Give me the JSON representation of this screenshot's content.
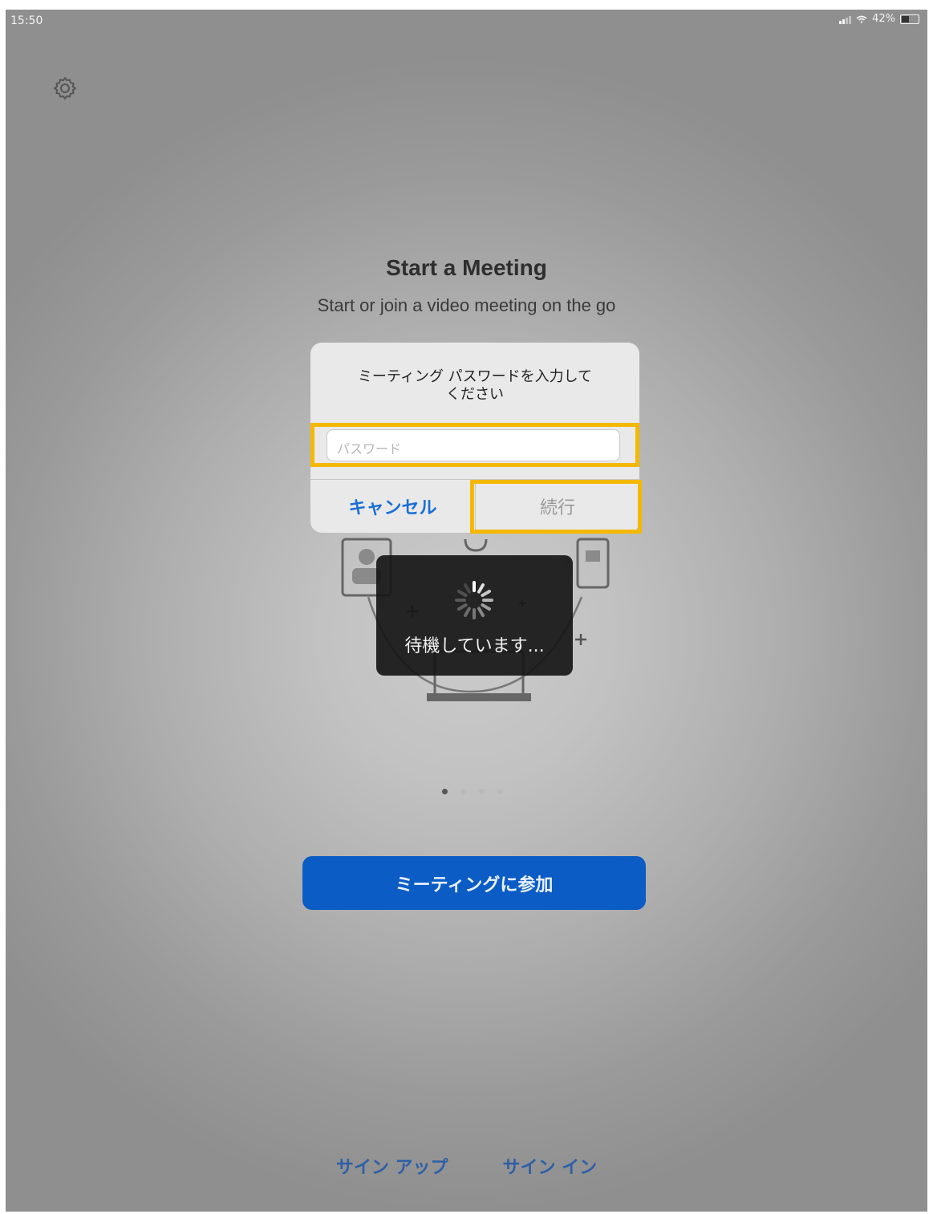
{
  "status_bar": {
    "time": "15:50",
    "battery": "42%"
  },
  "header": {
    "title": "Start a Meeting",
    "subtitle": "Start or join a video meeting on the go"
  },
  "password_dialog": {
    "title": "ミーティング パスワードを入力して\nください",
    "input_placeholder": "パスワード",
    "cancel_label": "キャンセル",
    "continue_label": "続行"
  },
  "loading": {
    "text": "待機しています..."
  },
  "pager": {
    "count": 4,
    "active_index": 0
  },
  "join_button": {
    "label": "ミーティングに参加"
  },
  "footer": {
    "signup_label": "サイン アップ",
    "signin_label": "サイン イン"
  },
  "colors": {
    "highlight": "#f5b800",
    "primary_blue": "#0b5cc5",
    "link_blue": "#1b6fd6"
  },
  "icons": {
    "settings": "gear-icon",
    "spinner": "spinner-icon"
  }
}
